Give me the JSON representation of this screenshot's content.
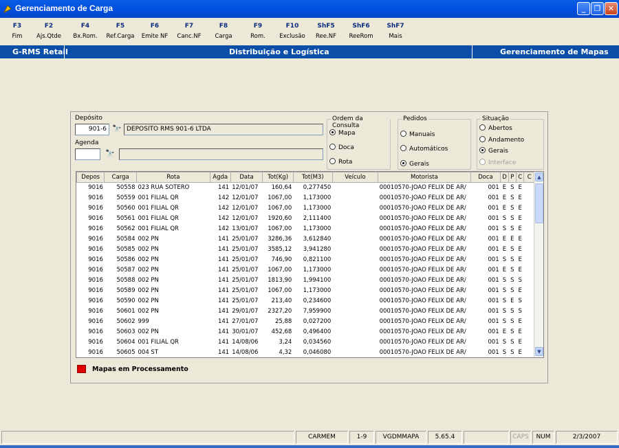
{
  "window": {
    "title": "Gerenciamento de Carga"
  },
  "fkeys": [
    {
      "key": "F3",
      "label": "Fim"
    },
    {
      "key": "F2",
      "label": "Ajs.Qtde"
    },
    {
      "key": "F4",
      "label": "Bx.Rom."
    },
    {
      "key": "F5",
      "label": "Ref.Carga"
    },
    {
      "key": "F6",
      "label": "Emite NF"
    },
    {
      "key": "F7",
      "label": "Canc.NF"
    },
    {
      "key": "F8",
      "label": "Carga"
    },
    {
      "key": "F9",
      "label": "Rom."
    },
    {
      "key": "F10",
      "label": "Exclusão"
    },
    {
      "key": "ShF5",
      "label": "Ree.NF"
    },
    {
      "key": "ShF6",
      "label": "ReeRom"
    },
    {
      "key": "ShF7",
      "label": "Mais"
    }
  ],
  "band": {
    "left": "G-RMS Retail",
    "center": "Distribuição e Logística",
    "right": "Gerenciamento de Mapas"
  },
  "form": {
    "deposito_label": "Depósito",
    "deposito_value": "901-6",
    "deposito_desc": "DEPOSITO RMS 901-6 LTDA",
    "agenda_label": "Agenda",
    "agenda_value": "",
    "agenda_desc": ""
  },
  "ordem": {
    "title": "Ordem da Consulta",
    "options": [
      "Mapa",
      "Doca",
      "Rota"
    ],
    "selected": "Mapa"
  },
  "pedidos": {
    "title": "Pedidos",
    "options": [
      "Manuais",
      "Automáticos",
      "Gerais"
    ],
    "selected": "Gerais"
  },
  "situacao": {
    "title": "Situação",
    "options": [
      "Abertos",
      "Andamento",
      "Gerais",
      "Interface"
    ],
    "selected": "Gerais",
    "disabled": "Interface"
  },
  "grid": {
    "columns": [
      "Depos",
      "Carga",
      "Rota",
      "Agda",
      "Data",
      "Tot(Kg)",
      "Tot(M3)",
      "Veículo",
      "Motorista",
      "Doca",
      "D",
      "P",
      "C",
      "C"
    ],
    "rows": [
      [
        "9016",
        "50558",
        "023 RUA SOTERO",
        "141",
        "12/01/07",
        "160,64",
        "0,277450",
        "",
        "00010570-JOAO FELIX DE AR/",
        "001",
        "E",
        "S",
        "E",
        ""
      ],
      [
        "9016",
        "50559",
        "001 FILIAL QR",
        "142",
        "12/01/07",
        "1067,00",
        "1,173000",
        "",
        "00010570-JOAO FELIX DE AR/",
        "001",
        "E",
        "S",
        "E",
        ""
      ],
      [
        "9016",
        "50560",
        "001 FILIAL QR",
        "142",
        "12/01/07",
        "1067,00",
        "1,173000",
        "",
        "00010570-JOAO FELIX DE AR/",
        "001",
        "E",
        "S",
        "E",
        ""
      ],
      [
        "9016",
        "50561",
        "001 FILIAL QR",
        "142",
        "12/01/07",
        "1920,60",
        "2,111400",
        "",
        "00010570-JOAO FELIX DE AR/",
        "001",
        "S",
        "S",
        "E",
        ""
      ],
      [
        "9016",
        "50562",
        "001 FILIAL QR",
        "142",
        "13/01/07",
        "1067,00",
        "1,173000",
        "",
        "00010570-JOAO FELIX DE AR/",
        "001",
        "S",
        "S",
        "E",
        ""
      ],
      [
        "9016",
        "50584",
        "002 PN",
        "141",
        "25/01/07",
        "3286,36",
        "3,612840",
        "",
        "00010570-JOAO FELIX DE AR/",
        "001",
        "E",
        "E",
        "E",
        ""
      ],
      [
        "9016",
        "50585",
        "002 PN",
        "141",
        "25/01/07",
        "3585,12",
        "3,941280",
        "",
        "00010570-JOAO FELIX DE AR/",
        "001",
        "E",
        "S",
        "E",
        ""
      ],
      [
        "9016",
        "50586",
        "002 PN",
        "141",
        "25/01/07",
        "746,90",
        "0,821100",
        "",
        "00010570-JOAO FELIX DE AR/",
        "001",
        "S",
        "S",
        "E",
        ""
      ],
      [
        "9016",
        "50587",
        "002 PN",
        "141",
        "25/01/07",
        "1067,00",
        "1,173000",
        "",
        "00010570-JOAO FELIX DE AR/",
        "001",
        "E",
        "S",
        "E",
        ""
      ],
      [
        "9016",
        "50588",
        "002 PN",
        "141",
        "25/01/07",
        "1813,90",
        "1,994100",
        "",
        "00010570-JOAO FELIX DE AR/",
        "001",
        "S",
        "S",
        "S",
        ""
      ],
      [
        "9016",
        "50589",
        "002 PN",
        "141",
        "25/01/07",
        "1067,00",
        "1,173000",
        "",
        "00010570-JOAO FELIX DE AR/",
        "001",
        "S",
        "S",
        "E",
        ""
      ],
      [
        "9016",
        "50590",
        "002 PN",
        "141",
        "25/01/07",
        "213,40",
        "0,234600",
        "",
        "00010570-JOAO FELIX DE AR/",
        "001",
        "S",
        "E",
        "S",
        ""
      ],
      [
        "9016",
        "50601",
        "002 PN",
        "141",
        "29/01/07",
        "2327,20",
        "7,959900",
        "",
        "00010570-JOAO FELIX DE AR/",
        "001",
        "S",
        "S",
        "S",
        ""
      ],
      [
        "9016",
        "50602",
        "999",
        "141",
        "27/01/07",
        "25,88",
        "0,027200",
        "",
        "00010570-JOAO FELIX DE AR/",
        "001",
        "S",
        "S",
        "E",
        ""
      ],
      [
        "9016",
        "50603",
        "002 PN",
        "141",
        "30/01/07",
        "452,68",
        "0,496400",
        "",
        "00010570-JOAO FELIX DE AR/",
        "001",
        "E",
        "S",
        "E",
        ""
      ],
      [
        "9016",
        "50604",
        "001 FILIAL QR",
        "141",
        "14/08/06",
        "3,24",
        "0,034560",
        "",
        "00010570-JOAO FELIX DE AR/",
        "001",
        "S",
        "S",
        "E",
        ""
      ],
      [
        "9016",
        "50605",
        "004 ST",
        "141",
        "14/08/06",
        "4,32",
        "0,046080",
        "",
        "00010570-JOAO FELIX DE AR/",
        "001",
        "S",
        "S",
        "E",
        ""
      ]
    ]
  },
  "legend": {
    "label": "Mapas em Processamento",
    "color": "#e00000"
  },
  "status": {
    "user": "CARMEM",
    "range": "1-9",
    "program": "VGDMMAPA",
    "version": "5.65.4",
    "caps": "CAPS",
    "num": "NUM",
    "date": "2/3/2007"
  }
}
